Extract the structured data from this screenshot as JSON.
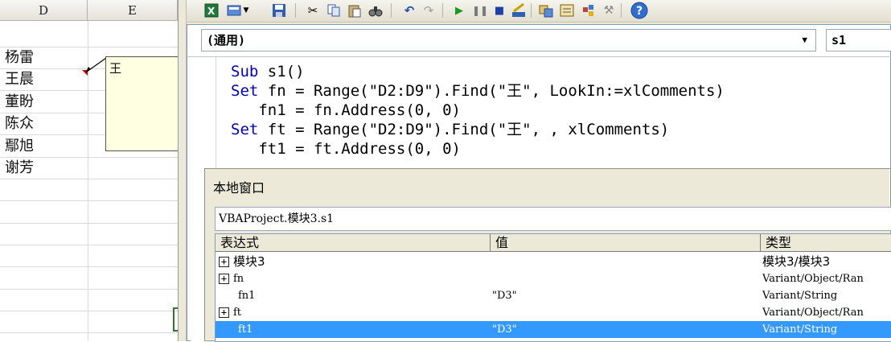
{
  "sheet": {
    "col_d": "D",
    "col_e": "E",
    "names": [
      "杨雷",
      "王晨",
      "董盼",
      "陈众",
      "鄢旭",
      "谢芳"
    ],
    "comment_text": "王"
  },
  "toolbar": {
    "icons": [
      "excel-icon",
      "insert-module-icon",
      "save-icon",
      "cut-icon",
      "copy-icon",
      "paste-icon",
      "find-icon",
      "undo-icon",
      "redo-icon",
      "run-icon",
      "break-icon",
      "reset-icon",
      "design-mode-icon",
      "project-explorer-icon",
      "properties-icon",
      "object-browser-icon",
      "toolbox-icon",
      "help-icon"
    ]
  },
  "code_window": {
    "object_combo": "(通用)",
    "proc_combo": "s1",
    "lines": [
      {
        "kw": "Sub",
        "rest": " s1()"
      },
      {
        "kw": "Set",
        "rest": " fn = Range(\"D2:D9\").Find(\"王\", LookIn:=xlComments)"
      },
      {
        "kw": "",
        "rest": "   fn1 = fn.Address(0, 0)"
      },
      {
        "kw": "Set",
        "rest": " ft = Range(\"D2:D9\").Find(\"王\", , xlComments)"
      },
      {
        "kw": "",
        "rest": "   ft1 = ft.Address(0, 0)"
      }
    ]
  },
  "locals": {
    "title": "本地窗口",
    "context": "VBAProject.模块3.s1",
    "headers": [
      "表达式",
      "值",
      "类型"
    ],
    "rows": [
      {
        "expr": "模块3",
        "value": "",
        "type": "模块3/模块3",
        "expandable": true,
        "selected": false
      },
      {
        "expr": "fn",
        "value": "",
        "type": "Variant/Object/Ran",
        "expandable": true,
        "selected": false
      },
      {
        "expr": "fn1",
        "value": "\"D3\"",
        "type": "Variant/String",
        "expandable": false,
        "selected": false
      },
      {
        "expr": "ft",
        "value": "",
        "type": "Variant/Object/Ran",
        "expandable": true,
        "selected": false
      },
      {
        "expr": "ft1",
        "value": "\"D3\"",
        "type": "Variant/String",
        "expandable": false,
        "selected": true
      }
    ]
  }
}
